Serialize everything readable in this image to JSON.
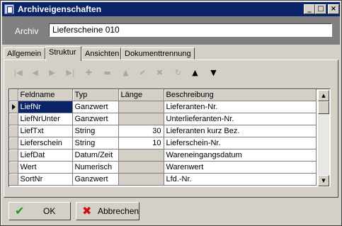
{
  "window": {
    "title": "Archiveigenschaften",
    "controls": {
      "minimize": "_",
      "maximize": "□",
      "close": "×"
    }
  },
  "header": {
    "archiv_label": "Archiv",
    "archiv_value": "Lieferscheine 010"
  },
  "tabs": [
    {
      "label": "Allgemein",
      "active": false
    },
    {
      "label": "Struktur",
      "active": true
    },
    {
      "label": "Ansichten",
      "active": false
    },
    {
      "label": "Dokumenttrennung",
      "active": false
    }
  ],
  "navigator": {
    "first": "|◀",
    "prior": "◀",
    "next": "▶",
    "last": "▶|",
    "insert": "✚",
    "delete": "▬",
    "edit": "▲",
    "post": "✔",
    "cancel": "✖",
    "refresh": "↻",
    "move_up": "▲",
    "move_down": "▼"
  },
  "grid": {
    "columns": [
      "Feldname",
      "Typ",
      "Länge",
      "Beschreibung"
    ],
    "rows": [
      {
        "feldname": "LiefNr",
        "typ": "Ganzwert",
        "laenge": "",
        "beschreibung": "Lieferanten-Nr.",
        "current": true
      },
      {
        "feldname": "LiefNrUnter",
        "typ": "Ganzwert",
        "laenge": "",
        "beschreibung": "Unterlieferanten-Nr."
      },
      {
        "feldname": "LiefTxt",
        "typ": "String",
        "laenge": "30",
        "beschreibung": "Lieferanten kurz Bez."
      },
      {
        "feldname": "Lieferschein",
        "typ": "String",
        "laenge": "10",
        "beschreibung": "Lieferschein-Nr."
      },
      {
        "feldname": "LiefDat",
        "typ": "Datum/Zeit",
        "laenge": "",
        "beschreibung": "Wareneingangsdatum"
      },
      {
        "feldname": "Wert",
        "typ": "Numerisch",
        "laenge": "",
        "beschreibung": "Warenwert"
      },
      {
        "feldname": "SortNr",
        "typ": "Ganzwert",
        "laenge": "",
        "beschreibung": "Lfd.-Nr."
      }
    ],
    "scroll_up": "▲",
    "scroll_down": "▼"
  },
  "buttons": {
    "ok_label": "OK",
    "ok_icon": "✔",
    "cancel_label": "Abbrechen",
    "cancel_icon": "✖"
  },
  "colors": {
    "titlebar": "#0a246a",
    "ok_icon": "#1a9a1a",
    "cancel_icon": "#cc1010",
    "face": "#d4d0c8"
  }
}
